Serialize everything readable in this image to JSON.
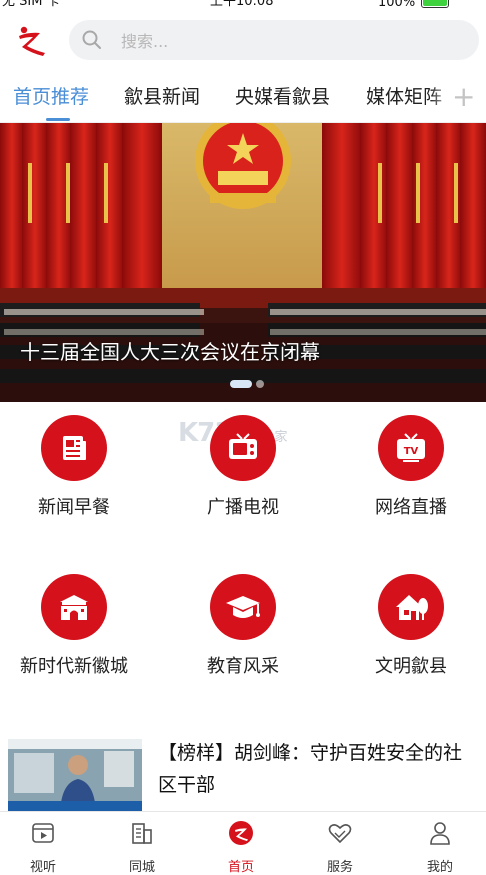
{
  "status_bar": {
    "carrier": "无 SIM 卡",
    "time": "上午10:08",
    "battery": "100%"
  },
  "header": {
    "search_placeholder": "搜索..."
  },
  "tabs": [
    {
      "label": "首页推荐"
    },
    {
      "label": "歙县新闻"
    },
    {
      "label": "央媒看歙县"
    },
    {
      "label": "媒体矩阵"
    }
  ],
  "banner": {
    "caption": "十三届全国人大三次会议在京闭幕"
  },
  "features": [
    {
      "label": "新闻早餐",
      "icon": "newspaper-icon"
    },
    {
      "label": "广播电视",
      "icon": "radio-tv-icon"
    },
    {
      "label": "网络直播",
      "icon": "tv-live-icon"
    },
    {
      "label": "新时代新徽城",
      "icon": "city-gate-icon"
    },
    {
      "label": "教育风采",
      "icon": "graduation-cap-icon"
    },
    {
      "label": "文明歙县",
      "icon": "house-tree-icon"
    }
  ],
  "watermark": {
    "brand": "K73",
    "sub": "游戏之家"
  },
  "news_item": {
    "title": "【榜样】胡剑峰：守护百姓安全的社区干部"
  },
  "bottom_nav": [
    {
      "label": "视听",
      "icon": "video-icon"
    },
    {
      "label": "同城",
      "icon": "building-icon"
    },
    {
      "label": "首页",
      "icon": "home-logo-icon"
    },
    {
      "label": "服务",
      "icon": "heart-hands-icon"
    },
    {
      "label": "我的",
      "icon": "user-icon"
    }
  ],
  "colors": {
    "accent_red": "#d5111b",
    "tab_active": "#4a8ed6"
  }
}
